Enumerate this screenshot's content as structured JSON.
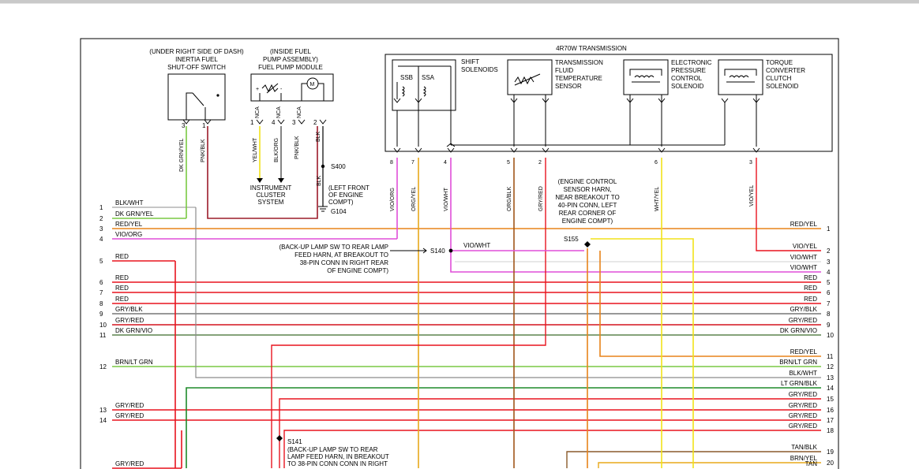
{
  "components": {
    "inertia_switch": {
      "location": "(UNDER RIGHT SIDE OF DASH)",
      "name1": "INERTIA FUEL",
      "name2": "SHUT-OFF SWITCH",
      "pin_a": "3",
      "pin_b": "1"
    },
    "fuel_pump": {
      "location1": "(INSIDE FUEL",
      "location2": "PUMP ASSEMBLY)",
      "name": "FUEL PUMP MODULE",
      "pins": [
        "1",
        "4",
        "3",
        "2"
      ],
      "nca": "NCA"
    },
    "transmission": {
      "name": "4R70W TRANSMISSION"
    },
    "shift_solenoids": {
      "label1": "SHIFT",
      "label2": "SOLENOIDS",
      "ssb": "SSB",
      "ssa": "SSA"
    },
    "tft_sensor": {
      "l1": "TRANSMISSION",
      "l2": "FLUID",
      "l3": "TEMPERATURE",
      "l4": "SENSOR"
    },
    "epc_solenoid": {
      "l1": "ELECTRONIC",
      "l2": "PRESSURE",
      "l3": "CONTROL",
      "l4": "SOLENOID"
    },
    "tcc_solenoid": {
      "l1": "TORQUE",
      "l2": "CONVERTER",
      "l3": "CLUTCH",
      "l4": "SOLENOID"
    },
    "instrument_cluster": {
      "l1": "INSTRUMENT",
      "l2": "CLUSTER",
      "l3": "SYSTEM"
    },
    "s400": {
      "name": "S400",
      "wire": "BLK"
    },
    "g104": {
      "name": "G104",
      "l1": "(LEFT FRONT",
      "l2": "OF ENGINE",
      "l3": "COMPT)"
    }
  },
  "wire_labels": {
    "dkgrnyel": "DK GRN/YEL",
    "pnkblk": "PNK/BLK",
    "yelwht": "YEL/WHT",
    "blkorg": "BLK/ORG",
    "blk": "BLK",
    "vioorg": "VIO/ORG",
    "orgyel": "ORG/YEL",
    "viowht": "VIO/WHT",
    "orgblk": "ORG/BLK",
    "gryred": "GRY/RED",
    "whtyel": "WHT/YEL",
    "vioyel": "VIO/YEL"
  },
  "trans_pins": [
    "8",
    "7",
    "4",
    "5",
    "2",
    "6",
    "3"
  ],
  "splices": {
    "s140": {
      "name": "S140",
      "wire": "VIO/WHT",
      "note": [
        "(BACK-UP LAMP SW TO REAR LAMP",
        "FEED HARN, AT BREAKOUT TO",
        "38-PIN CONN IN RIGHT REAR",
        "OF ENGINE COMPT)"
      ]
    },
    "s155": {
      "name": "S155",
      "note": [
        "(ENGINE CONTROL",
        "SENSOR HARN,",
        "NEAR BREAKOUT TO",
        "40-PIN CONN, LEFT",
        "REAR CORNER OF",
        "ENGINE COMPT)"
      ]
    },
    "s141": {
      "name": "S141",
      "note": [
        "(BACK-UP LAMP SW TO REAR",
        "LAMP FEED HARN, IN BREAKOUT",
        "TO 38-PIN CONN CONN IN RIGHT"
      ]
    }
  },
  "left_rows": [
    {
      "num": "1",
      "label": "BLK/WHT"
    },
    {
      "num": "2",
      "label": "DK GRN/YEL"
    },
    {
      "num": "3",
      "label": "RED/YEL"
    },
    {
      "num": "4",
      "label": "VIO/ORG"
    },
    {
      "num": "5",
      "label": "RED"
    },
    {
      "num": "6",
      "label": "RED"
    },
    {
      "num": "7",
      "label": "RED"
    },
    {
      "num": "8",
      "label": "RED"
    },
    {
      "num": "9",
      "label": "GRY/BLK"
    },
    {
      "num": "10",
      "label": "GRY/RED"
    },
    {
      "num": "11",
      "label": "DK GRN/VIO"
    },
    {
      "num": "12",
      "label": "BRN/LT GRN"
    },
    {
      "num": "13",
      "label": "GRY/RED"
    },
    {
      "num": "14",
      "label": "GRY/RED"
    },
    {
      "num": "",
      "label": "GRY/RED"
    }
  ],
  "right_rows": [
    {
      "num": "1",
      "label": "RED/YEL"
    },
    {
      "num": "2",
      "label": "VIO/YEL"
    },
    {
      "num": "3",
      "label": "VIO/WHT"
    },
    {
      "num": "4",
      "label": "VIO/WHT"
    },
    {
      "num": "5",
      "label": "RED"
    },
    {
      "num": "6",
      "label": "RED"
    },
    {
      "num": "7",
      "label": "RED"
    },
    {
      "num": "8",
      "label": "GRY/BLK"
    },
    {
      "num": "9",
      "label": "GRY/RED"
    },
    {
      "num": "10",
      "label": "DK GRN/VIO"
    },
    {
      "num": "11",
      "label": "RED/YEL"
    },
    {
      "num": "12",
      "label": "BRN/LT GRN"
    },
    {
      "num": "13",
      "label": "BLK/WHT"
    },
    {
      "num": "14",
      "label": "LT GRN/BLK"
    },
    {
      "num": "15",
      "label": "GRY/RED"
    },
    {
      "num": "16",
      "label": "GRY/RED"
    },
    {
      "num": "17",
      "label": "GRY/RED"
    },
    {
      "num": "18",
      "label": "GRY/RED"
    },
    {
      "num": "19",
      "label": "TAN/BLK"
    },
    {
      "num": "20",
      "label": "BRN/YEL"
    },
    {
      "num": "",
      "label": "TAN"
    }
  ],
  "colors": {
    "red": "#e8141e",
    "green": "#7ac943",
    "darkgreen": "#1e8a2a",
    "orange": "#e8841a",
    "violet": "#e04fd8",
    "yellow": "#f2e21a",
    "grey": "#8c8c8c",
    "darkred": "#9c1b2a",
    "brown": "#8a5a2b"
  }
}
